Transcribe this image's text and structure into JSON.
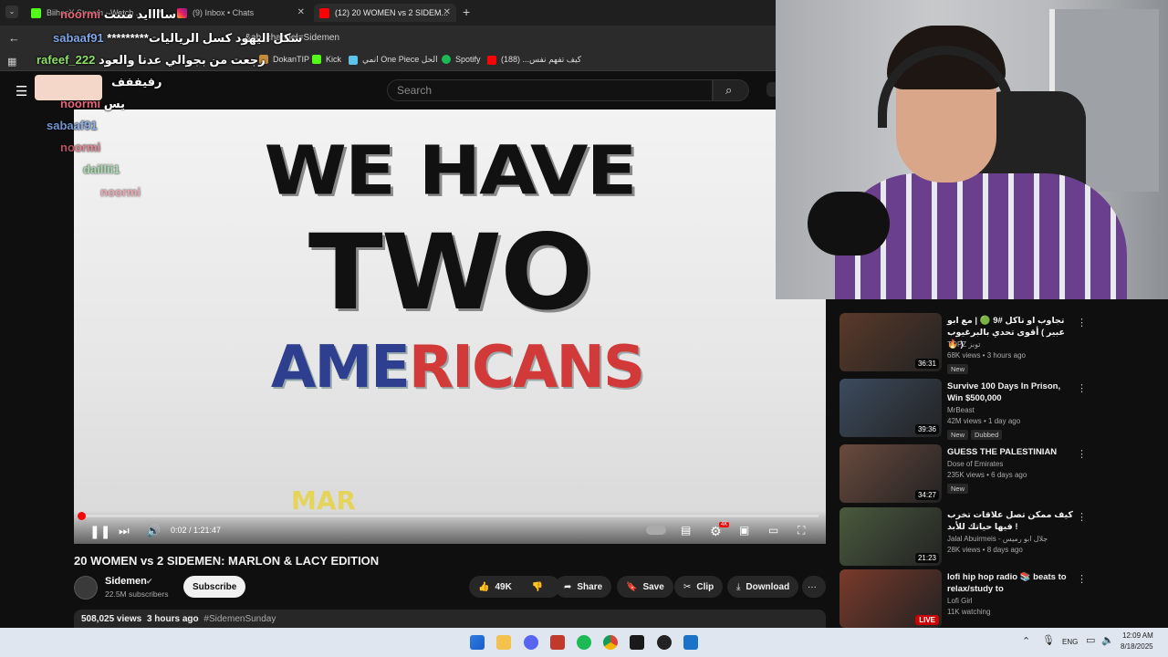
{
  "browser": {
    "tabs": [
      {
        "label": "BiihasX Stream - Watch ...",
        "active": false
      },
      {
        "label": "(9) Inbox • Chats",
        "active": false
      },
      {
        "label": "(12) 20 WOMEN vs 2 SIDEM...",
        "active": true
      }
    ],
    "new_tab": "+",
    "address": "...&ab_channel=Sidemen",
    "bookmarks": [
      "DokanTIP",
      "Kick",
      "انمي One Piece الحل",
      "Spotify",
      "كيف تفهم نفس... (188)"
    ]
  },
  "youtube": {
    "search_placeholder": "Search",
    "video_text": {
      "line1": "WE HAVE",
      "line2": "TWO",
      "line3a": "AME",
      "line3b": "RICANS",
      "line4": "MAR"
    },
    "player": {
      "time": "0:02 / 1:21:47",
      "progress": 0.001,
      "badge_4k": "4K"
    },
    "title": "20 WOMEN vs 2 SIDEMEN: MARLON & LACY EDITION",
    "channel": {
      "name": "Sidemen",
      "subs": "22.5M subscribers",
      "subscribe": "Subscribe"
    },
    "actions": {
      "likes": "49K",
      "share": "Share",
      "save": "Save",
      "clip": "Clip",
      "download": "Download",
      "more": "···"
    },
    "description": {
      "views": "508,025 views",
      "age": "3 hours ago",
      "tag": "#SidemenSunday"
    },
    "recommendations": [
      {
        "title": "تجاوب او تاكل #9 🟢 | مع ابو عبير ) أقوى تحدي بالبرغيوب 🔥 )",
        "channel": "TOPZ توبز",
        "meta": "68K views • 3 hours ago",
        "badges": [
          "New"
        ],
        "duration": "36:31",
        "thumb": "#5a3a2a"
      },
      {
        "title": "Survive 100 Days In Prison, Win $500,000",
        "channel": "MrBeast",
        "meta": "42M views • 1 day ago",
        "badges": [
          "New",
          "Dubbed"
        ],
        "duration": "39:36",
        "thumb": "#3c4b5e"
      },
      {
        "title": "GUESS THE PALESTINIAN",
        "channel": "Dose of Emirates",
        "meta": "235K views • 6 days ago",
        "badges": [
          "New"
        ],
        "duration": "34:27",
        "thumb": "#6a4a3e"
      },
      {
        "title": "كيف ممكن تصل علاقات تخرب فيها حياتك للأبد !",
        "channel": "Jalal Abuirmeis - جلال ابو رميس",
        "meta": "28K views • 8 days ago",
        "badges": [],
        "duration": "21:23",
        "thumb": "#4a5a3e"
      },
      {
        "title": "lofi hip hop radio 📚 beats to relax/study to",
        "channel": "Lofi Girl",
        "meta": "11K watching",
        "badges": [],
        "duration": "LIVE",
        "thumb": "#7a3a2a"
      }
    ]
  },
  "chat": [
    {
      "user": "noormi",
      "msg": "ساااايد منتت",
      "color": "#e8677a"
    },
    {
      "user": "sabaaf91",
      "msg": "*********شكل اليهود كسل الرياليات",
      "color": "#7fa6e8"
    },
    {
      "user": "rafeef_222",
      "msg": "رجعت من بجوالي عدنا والعود",
      "color": "#8ee06a"
    },
    {
      "user": "",
      "msg": "رفيففف",
      "color": "#ffffff"
    },
    {
      "user": "noormi",
      "msg": "يس",
      "color": "#e8677a"
    },
    {
      "user": "sabaaf91",
      "msg": "",
      "color": "#7fa6e8"
    },
    {
      "user": "noormi",
      "msg": "",
      "color": "#e8677a"
    },
    {
      "user": "daillii1",
      "msg": "",
      "color": "#7fd08a"
    },
    {
      "user": "noormi",
      "msg": "",
      "color": "#e8677a"
    }
  ],
  "taskbar": {
    "lang": "ENG",
    "time": "12:09 AM",
    "date": "8/18/2025"
  }
}
